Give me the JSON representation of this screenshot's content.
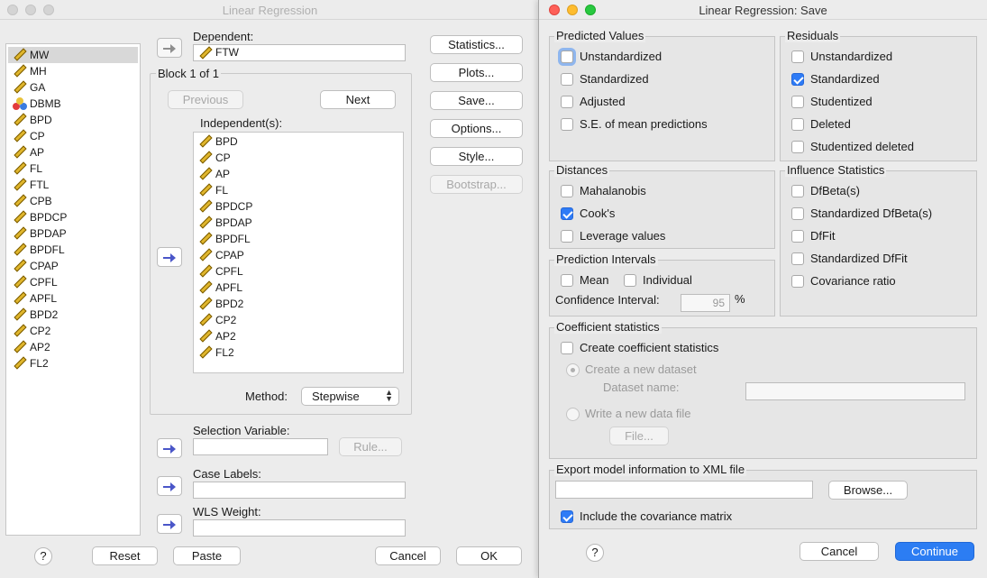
{
  "main_dialog": {
    "title": "Linear Regression",
    "variables": [
      "MW",
      "MH",
      "GA",
      "DBMB",
      "BPD",
      "CP",
      "AP",
      "FL",
      "FTL",
      "CPB",
      "BPDCP",
      "BPDAP",
      "BPDFL",
      "CPAP",
      "CPFL",
      "APFL",
      "BPD2",
      "CP2",
      "AP2",
      "FL2"
    ],
    "variable_icons": [
      "scale-ruler-icon",
      "scale-ruler-icon",
      "scale-ruler-icon",
      "nominal-icon",
      "scale-ruler-icon",
      "scale-ruler-icon",
      "scale-ruler-icon",
      "scale-ruler-icon",
      "scale-ruler-icon",
      "scale-ruler-icon",
      "scale-ruler-icon",
      "scale-ruler-icon",
      "scale-ruler-icon",
      "scale-ruler-icon",
      "scale-ruler-icon",
      "scale-ruler-icon",
      "scale-ruler-icon",
      "scale-ruler-icon",
      "scale-ruler-icon",
      "scale-ruler-icon"
    ],
    "selected_variable": "MW",
    "dependent_label": "Dependent:",
    "dependent_value": "FTW",
    "block_label": "Block 1 of 1",
    "previous_label": "Previous",
    "next_label": "Next",
    "independents_label": "Independent(s):",
    "independents": [
      "BPD",
      "CP",
      "AP",
      "FL",
      "BPDCP",
      "BPDAP",
      "BPDFL",
      "CPAP",
      "CPFL",
      "APFL",
      "BPD2",
      "CP2",
      "AP2",
      "FL2"
    ],
    "method_label": "Method:",
    "method_value": "Stepwise",
    "selection_variable_label": "Selection Variable:",
    "rule_label": "Rule...",
    "case_labels_label": "Case Labels:",
    "wls_weight_label": "WLS Weight:",
    "side_buttons": [
      "Statistics...",
      "Plots...",
      "Save...",
      "Options...",
      "Style...",
      "Bootstrap..."
    ],
    "help_label": "?",
    "reset_label": "Reset",
    "paste_label": "Paste",
    "cancel_label": "Cancel",
    "ok_label": "OK"
  },
  "save_dialog": {
    "title": "Linear Regression: Save",
    "predicted_values": {
      "title": "Predicted Values",
      "items": [
        {
          "label": "Unstandardized",
          "checked": false
        },
        {
          "label": "Standardized",
          "checked": false
        },
        {
          "label": "Adjusted",
          "checked": false
        },
        {
          "label": "S.E. of mean predictions",
          "checked": false
        }
      ]
    },
    "residuals": {
      "title": "Residuals",
      "items": [
        {
          "label": "Unstandardized",
          "checked": false
        },
        {
          "label": "Standardized",
          "checked": true
        },
        {
          "label": "Studentized",
          "checked": false
        },
        {
          "label": "Deleted",
          "checked": false
        },
        {
          "label": "Studentized deleted",
          "checked": false
        }
      ]
    },
    "distances": {
      "title": "Distances",
      "items": [
        {
          "label": "Mahalanobis",
          "checked": false
        },
        {
          "label": "Cook's",
          "checked": true
        },
        {
          "label": "Leverage values",
          "checked": false
        }
      ]
    },
    "influence": {
      "title": "Influence Statistics",
      "items": [
        {
          "label": "DfBeta(s)",
          "checked": false
        },
        {
          "label": "Standardized DfBeta(s)",
          "checked": false
        },
        {
          "label": "DfFit",
          "checked": false
        },
        {
          "label": "Standardized DfFit",
          "checked": false
        },
        {
          "label": "Covariance ratio",
          "checked": false
        }
      ]
    },
    "prediction_intervals": {
      "title": "Prediction Intervals",
      "mean_label": "Mean",
      "individual_label": "Individual",
      "confidence_label": "Confidence Interval:",
      "confidence_value": "95",
      "percent": "%"
    },
    "coefficient": {
      "title": "Coefficient statistics",
      "create_label": "Create coefficient statistics",
      "new_dataset_label": "Create a new dataset",
      "dataset_name_label": "Dataset name:",
      "new_file_label": "Write a new data file",
      "file_button": "File..."
    },
    "export": {
      "title": "Export model information to XML file",
      "browse_label": "Browse...",
      "covariance_label": "Include the covariance matrix",
      "covariance_checked": true
    },
    "help_label": "?",
    "cancel_label": "Cancel",
    "continue_label": "Continue"
  },
  "colors": {
    "accent": "#2c7df3",
    "scale_icon": "#e0b62c",
    "selection": "#d8d8d8"
  }
}
